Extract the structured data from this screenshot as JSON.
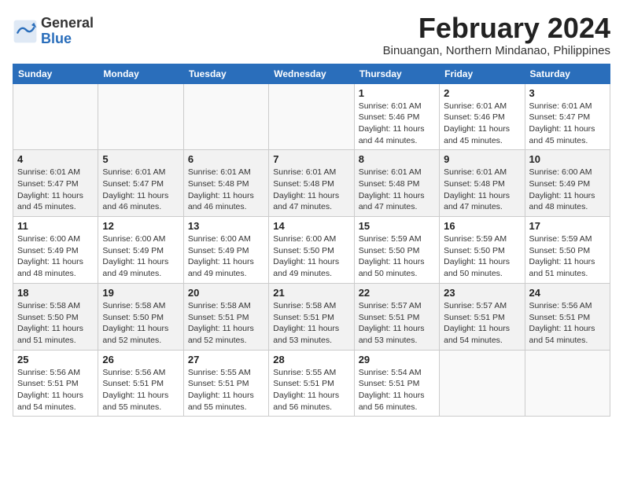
{
  "header": {
    "logo_general": "General",
    "logo_blue": "Blue",
    "month_title": "February 2024",
    "subtitle": "Binuangan, Northern Mindanao, Philippines"
  },
  "columns": [
    "Sunday",
    "Monday",
    "Tuesday",
    "Wednesday",
    "Thursday",
    "Friday",
    "Saturday"
  ],
  "weeks": [
    {
      "bg": "light",
      "days": [
        {
          "num": "",
          "info": ""
        },
        {
          "num": "",
          "info": ""
        },
        {
          "num": "",
          "info": ""
        },
        {
          "num": "",
          "info": ""
        },
        {
          "num": "1",
          "info": "Sunrise: 6:01 AM\nSunset: 5:46 PM\nDaylight: 11 hours\nand 44 minutes."
        },
        {
          "num": "2",
          "info": "Sunrise: 6:01 AM\nSunset: 5:46 PM\nDaylight: 11 hours\nand 45 minutes."
        },
        {
          "num": "3",
          "info": "Sunrise: 6:01 AM\nSunset: 5:47 PM\nDaylight: 11 hours\nand 45 minutes."
        }
      ]
    },
    {
      "bg": "alt",
      "days": [
        {
          "num": "4",
          "info": "Sunrise: 6:01 AM\nSunset: 5:47 PM\nDaylight: 11 hours\nand 45 minutes."
        },
        {
          "num": "5",
          "info": "Sunrise: 6:01 AM\nSunset: 5:47 PM\nDaylight: 11 hours\nand 46 minutes."
        },
        {
          "num": "6",
          "info": "Sunrise: 6:01 AM\nSunset: 5:48 PM\nDaylight: 11 hours\nand 46 minutes."
        },
        {
          "num": "7",
          "info": "Sunrise: 6:01 AM\nSunset: 5:48 PM\nDaylight: 11 hours\nand 47 minutes."
        },
        {
          "num": "8",
          "info": "Sunrise: 6:01 AM\nSunset: 5:48 PM\nDaylight: 11 hours\nand 47 minutes."
        },
        {
          "num": "9",
          "info": "Sunrise: 6:01 AM\nSunset: 5:48 PM\nDaylight: 11 hours\nand 47 minutes."
        },
        {
          "num": "10",
          "info": "Sunrise: 6:00 AM\nSunset: 5:49 PM\nDaylight: 11 hours\nand 48 minutes."
        }
      ]
    },
    {
      "bg": "light",
      "days": [
        {
          "num": "11",
          "info": "Sunrise: 6:00 AM\nSunset: 5:49 PM\nDaylight: 11 hours\nand 48 minutes."
        },
        {
          "num": "12",
          "info": "Sunrise: 6:00 AM\nSunset: 5:49 PM\nDaylight: 11 hours\nand 49 minutes."
        },
        {
          "num": "13",
          "info": "Sunrise: 6:00 AM\nSunset: 5:49 PM\nDaylight: 11 hours\nand 49 minutes."
        },
        {
          "num": "14",
          "info": "Sunrise: 6:00 AM\nSunset: 5:50 PM\nDaylight: 11 hours\nand 49 minutes."
        },
        {
          "num": "15",
          "info": "Sunrise: 5:59 AM\nSunset: 5:50 PM\nDaylight: 11 hours\nand 50 minutes."
        },
        {
          "num": "16",
          "info": "Sunrise: 5:59 AM\nSunset: 5:50 PM\nDaylight: 11 hours\nand 50 minutes."
        },
        {
          "num": "17",
          "info": "Sunrise: 5:59 AM\nSunset: 5:50 PM\nDaylight: 11 hours\nand 51 minutes."
        }
      ]
    },
    {
      "bg": "alt",
      "days": [
        {
          "num": "18",
          "info": "Sunrise: 5:58 AM\nSunset: 5:50 PM\nDaylight: 11 hours\nand 51 minutes."
        },
        {
          "num": "19",
          "info": "Sunrise: 5:58 AM\nSunset: 5:50 PM\nDaylight: 11 hours\nand 52 minutes."
        },
        {
          "num": "20",
          "info": "Sunrise: 5:58 AM\nSunset: 5:51 PM\nDaylight: 11 hours\nand 52 minutes."
        },
        {
          "num": "21",
          "info": "Sunrise: 5:58 AM\nSunset: 5:51 PM\nDaylight: 11 hours\nand 53 minutes."
        },
        {
          "num": "22",
          "info": "Sunrise: 5:57 AM\nSunset: 5:51 PM\nDaylight: 11 hours\nand 53 minutes."
        },
        {
          "num": "23",
          "info": "Sunrise: 5:57 AM\nSunset: 5:51 PM\nDaylight: 11 hours\nand 54 minutes."
        },
        {
          "num": "24",
          "info": "Sunrise: 5:56 AM\nSunset: 5:51 PM\nDaylight: 11 hours\nand 54 minutes."
        }
      ]
    },
    {
      "bg": "light",
      "days": [
        {
          "num": "25",
          "info": "Sunrise: 5:56 AM\nSunset: 5:51 PM\nDaylight: 11 hours\nand 54 minutes."
        },
        {
          "num": "26",
          "info": "Sunrise: 5:56 AM\nSunset: 5:51 PM\nDaylight: 11 hours\nand 55 minutes."
        },
        {
          "num": "27",
          "info": "Sunrise: 5:55 AM\nSunset: 5:51 PM\nDaylight: 11 hours\nand 55 minutes."
        },
        {
          "num": "28",
          "info": "Sunrise: 5:55 AM\nSunset: 5:51 PM\nDaylight: 11 hours\nand 56 minutes."
        },
        {
          "num": "29",
          "info": "Sunrise: 5:54 AM\nSunset: 5:51 PM\nDaylight: 11 hours\nand 56 minutes."
        },
        {
          "num": "",
          "info": ""
        },
        {
          "num": "",
          "info": ""
        }
      ]
    }
  ]
}
